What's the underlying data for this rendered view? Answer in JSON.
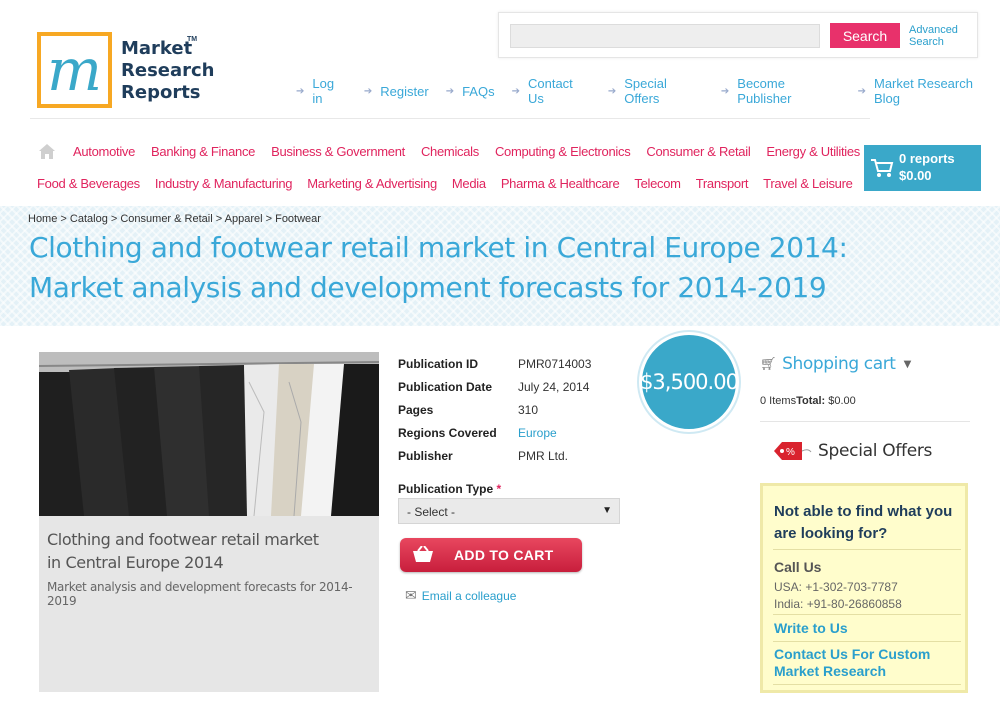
{
  "logo": {
    "text_line1": "Market",
    "text_line2": "Research",
    "text_line3": "Reports",
    "tm": "TM"
  },
  "search": {
    "placeholder": "",
    "button_label": "Search",
    "advanced_line1": "Advanced",
    "advanced_line2": "Search"
  },
  "top_links": [
    "Log in",
    "Register",
    "FAQs",
    "Contact Us",
    "Special Offers",
    "Become Publisher",
    "Market Research Blog"
  ],
  "categories_row1": [
    "Automotive",
    "Banking & Finance",
    "Business & Government",
    "Chemicals",
    "Computing & Electronics",
    "Consumer & Retail",
    "Energy & Utilities"
  ],
  "categories_row2": [
    "Food & Beverages",
    "Industry & Manufacturing",
    "Marketing & Advertising",
    "Media",
    "Pharma & Healthcare",
    "Telecom",
    "Transport",
    "Travel & Leisure"
  ],
  "mini_cart": {
    "reports": "0 reports",
    "total": "$0.00"
  },
  "breadcrumb": [
    "Home",
    "Catalog",
    "Consumer & Retail",
    "Apparel",
    "Footwear"
  ],
  "page_title": "Clothing and footwear retail market in Central Europe 2014: Market analysis and development forecasts for 2014-2019",
  "product_image": {
    "caption_line1": "Clothing and footwear retail market",
    "caption_line2": "in Central Europe 2014",
    "caption_line3": "Market analysis and development forecasts for 2014-2019"
  },
  "details": [
    {
      "label": "Publication ID",
      "value": "PMR0714003",
      "link": false
    },
    {
      "label": "Publication Date",
      "value": "July 24, 2014",
      "link": false
    },
    {
      "label": "Pages",
      "value": "310",
      "link": false
    },
    {
      "label": "Regions Covered",
      "value": "Europe",
      "link": true
    },
    {
      "label": "Publisher",
      "value": "PMR Ltd.",
      "link": false
    }
  ],
  "price": "$3,500.00",
  "publication_type": {
    "label": "Publication Type",
    "required_mark": "*",
    "selected": "- Select -"
  },
  "add_to_cart_label": "ADD TO CART",
  "email_colleague_label": "Email a colleague",
  "sidebar": {
    "shopping_cart_title": "Shopping cart",
    "cart_items": "0 Items",
    "cart_total_label": "Total:",
    "cart_total_value": "$0.00",
    "special_offers_label": "Special Offers",
    "special_tag_symbol": "%",
    "help_question": "Not able to find what you are looking for?",
    "call_us_title": "Call Us",
    "call_usa": "USA: +1-302-703-7787",
    "call_india": "India: +91-80-26860858",
    "write_to_us": "Write to Us",
    "contact_custom": "Contact Us For Custom Market Research"
  },
  "colors": {
    "accent_blue": "#3aa8d8",
    "accent_pink": "#e0245e",
    "logo_orange": "#f7a823",
    "help_box_bg": "#fffdcc"
  }
}
